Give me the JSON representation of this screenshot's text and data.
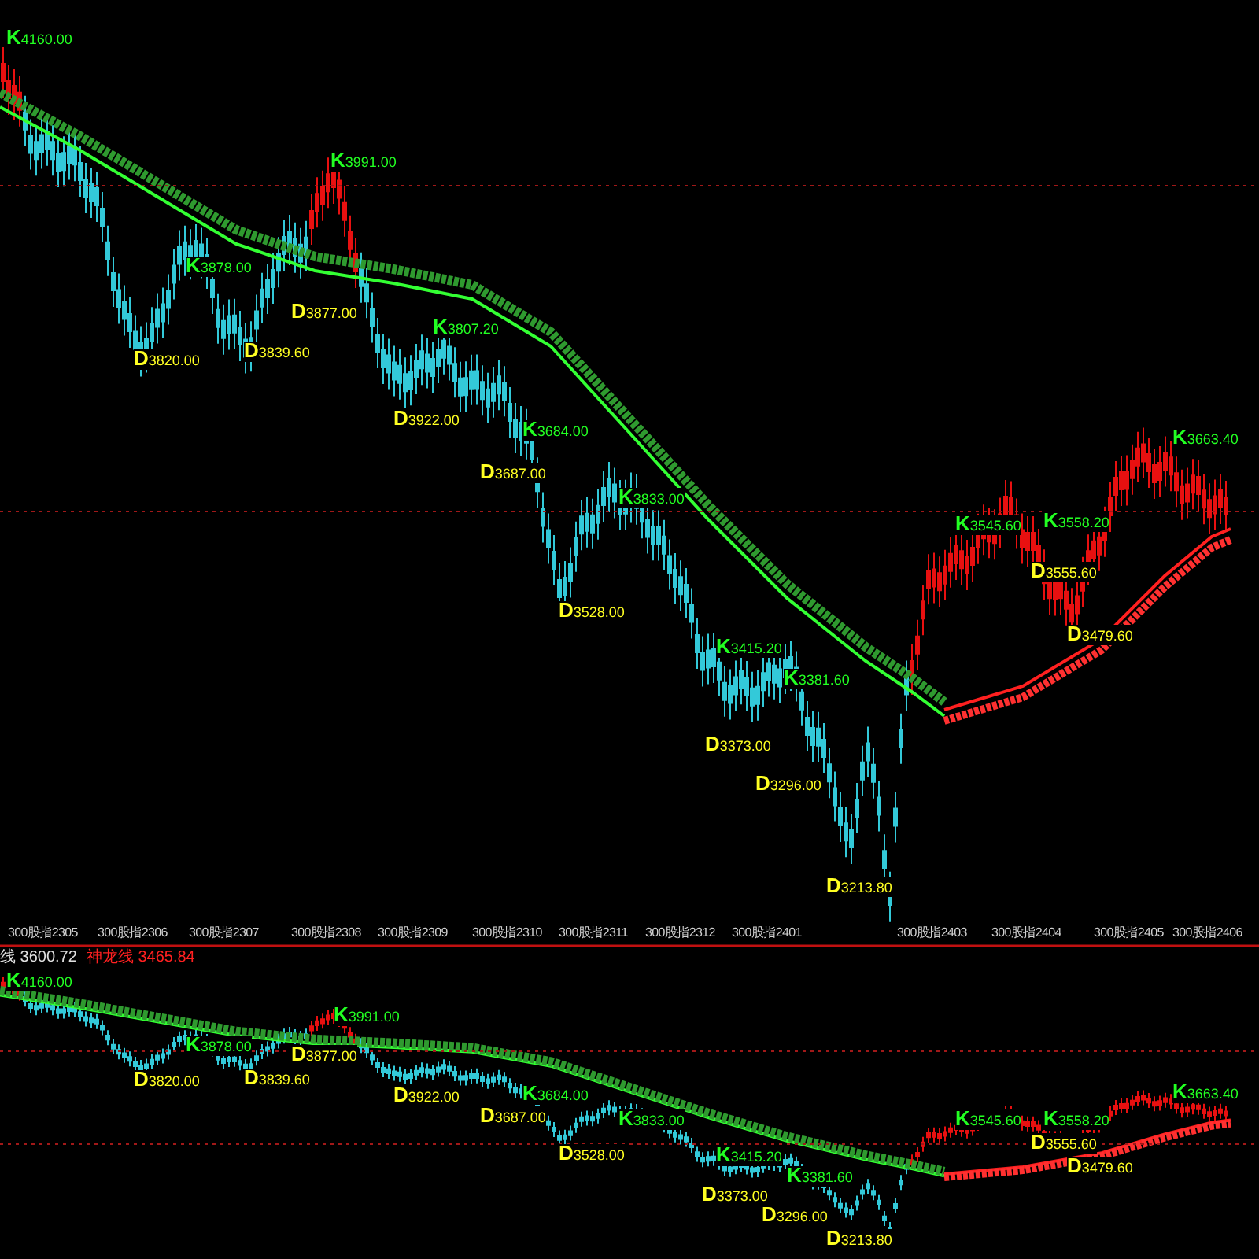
{
  "main_chart": {
    "x_axis_labels": [
      "300股指2305",
      "300股指2306",
      "300股指2307",
      "300股指2308",
      "300股指2309",
      "300股指2310",
      "300股指2311",
      "300股指2312",
      "300股指2401",
      "300股指2403",
      "300股指2404",
      "300股指2405",
      "300股指2406"
    ],
    "markers": [
      {
        "kind": "peak",
        "letter": "K",
        "value": "4160.00"
      },
      {
        "kind": "peak",
        "letter": "K",
        "value": "3991.00"
      },
      {
        "kind": "peak",
        "letter": "K",
        "value": "3878.00"
      },
      {
        "kind": "trough",
        "letter": "D",
        "value": "3877.00"
      },
      {
        "kind": "trough",
        "letter": "D",
        "value": "3820.00"
      },
      {
        "kind": "trough",
        "letter": "D",
        "value": "3839.60"
      },
      {
        "kind": "peak",
        "letter": "K",
        "value": "3807.20"
      },
      {
        "kind": "trough",
        "letter": "D",
        "value": "3922.00"
      },
      {
        "kind": "peak",
        "letter": "K",
        "value": "3684.00"
      },
      {
        "kind": "trough",
        "letter": "D",
        "value": "3687.00"
      },
      {
        "kind": "peak",
        "letter": "K",
        "value": "3833.00"
      },
      {
        "kind": "trough",
        "letter": "D",
        "value": "3528.00"
      },
      {
        "kind": "peak",
        "letter": "K",
        "value": "3415.20"
      },
      {
        "kind": "peak",
        "letter": "K",
        "value": "3381.60"
      },
      {
        "kind": "trough",
        "letter": "D",
        "value": "3373.00"
      },
      {
        "kind": "trough",
        "letter": "D",
        "value": "3296.00"
      },
      {
        "kind": "trough",
        "letter": "D",
        "value": "3213.80"
      },
      {
        "kind": "peak",
        "letter": "K",
        "value": "3545.60"
      },
      {
        "kind": "peak",
        "letter": "K",
        "value": "3558.20"
      },
      {
        "kind": "trough",
        "letter": "D",
        "value": "3555.60"
      },
      {
        "kind": "trough",
        "letter": "D",
        "value": "3479.60"
      },
      {
        "kind": "peak",
        "letter": "K",
        "value": "3663.40"
      }
    ]
  },
  "sub_chart": {
    "legend": [
      {
        "label": "线 3600.72",
        "color": "#e0e0e0"
      },
      {
        "label": "神龙线 3465.84",
        "color": "#ff2020"
      }
    ],
    "markers": [
      {
        "kind": "peak",
        "letter": "K",
        "value": "4160.00"
      },
      {
        "kind": "peak",
        "letter": "K",
        "value": "3991.00"
      },
      {
        "kind": "peak",
        "letter": "K",
        "value": "3878.00"
      },
      {
        "kind": "trough",
        "letter": "D",
        "value": "3877.00"
      },
      {
        "kind": "trough",
        "letter": "D",
        "value": "3820.00"
      },
      {
        "kind": "trough",
        "letter": "D",
        "value": "3839.60"
      },
      {
        "kind": "trough",
        "letter": "D",
        "value": "3922.00"
      },
      {
        "kind": "peak",
        "letter": "K",
        "value": "3684.00"
      },
      {
        "kind": "trough",
        "letter": "D",
        "value": "3687.00"
      },
      {
        "kind": "peak",
        "letter": "K",
        "value": "3833.00"
      },
      {
        "kind": "trough",
        "letter": "D",
        "value": "3528.00"
      },
      {
        "kind": "peak",
        "letter": "K",
        "value": "3415.20"
      },
      {
        "kind": "peak",
        "letter": "K",
        "value": "3381.60"
      },
      {
        "kind": "trough",
        "letter": "D",
        "value": "3373.00"
      },
      {
        "kind": "trough",
        "letter": "D",
        "value": "3296.00"
      },
      {
        "kind": "trough",
        "letter": "D",
        "value": "3213.80"
      },
      {
        "kind": "peak",
        "letter": "K",
        "value": "3545.60"
      },
      {
        "kind": "peak",
        "letter": "K",
        "value": "3558.20"
      },
      {
        "kind": "trough",
        "letter": "D",
        "value": "3555.60"
      },
      {
        "kind": "trough",
        "letter": "D",
        "value": "3479.60"
      },
      {
        "kind": "peak",
        "letter": "K",
        "value": "3663.40"
      }
    ]
  }
}
